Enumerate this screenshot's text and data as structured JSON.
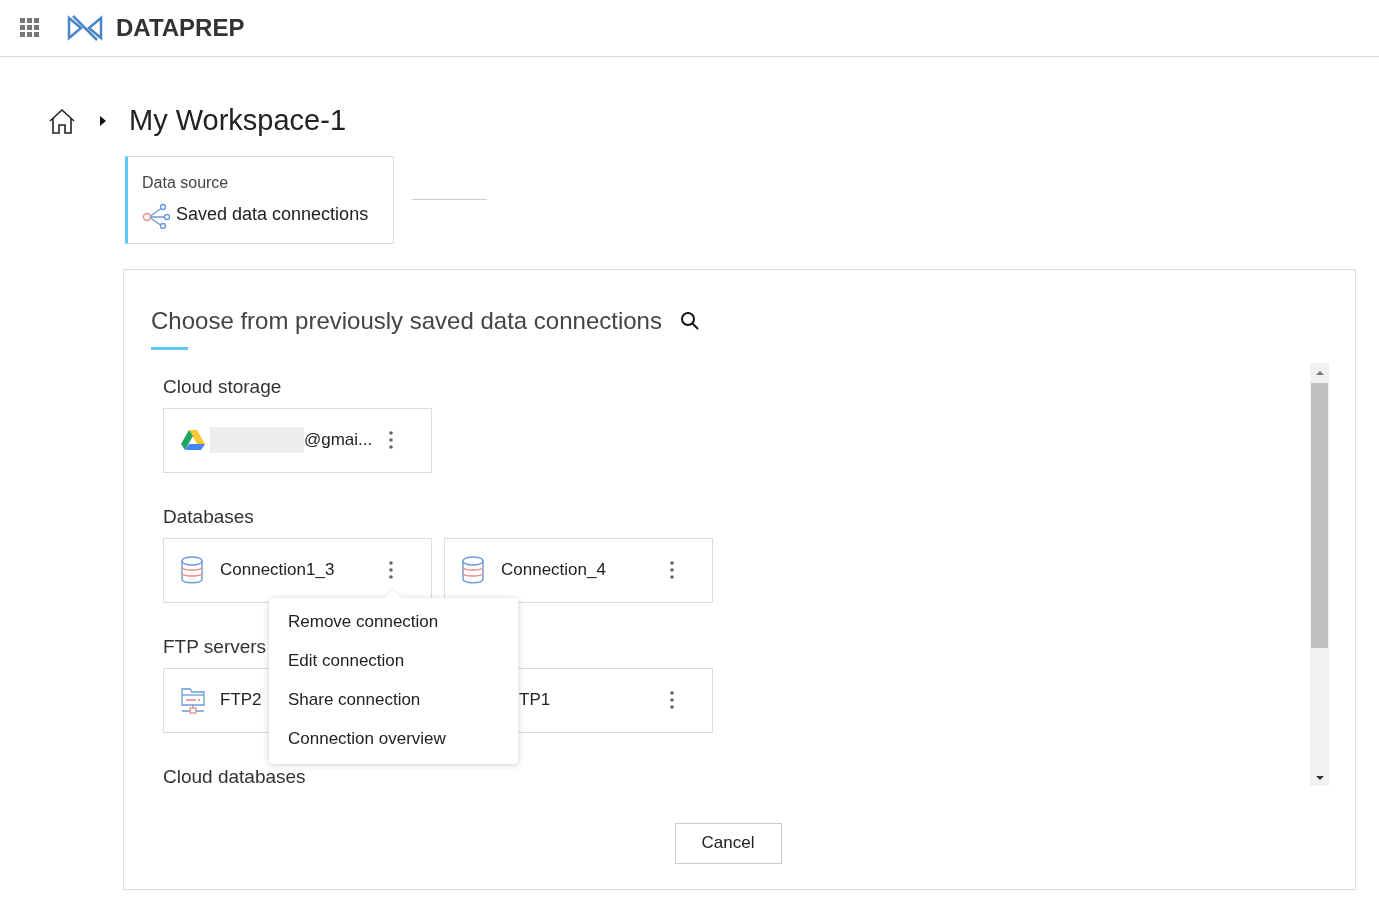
{
  "app": {
    "title": "DATAPREP"
  },
  "breadcrumb": {
    "title": "My Workspace-1"
  },
  "steps": [
    {
      "label": "Data source",
      "value": "Saved data connections",
      "selected": true
    }
  ],
  "panel": {
    "title": "Choose from previously saved data connections",
    "sections": [
      {
        "title": "Cloud storage",
        "connections": [
          {
            "kind": "drive",
            "name": "@gmai...",
            "redacted": true,
            "menu_open": false
          }
        ]
      },
      {
        "title": "Databases",
        "connections": [
          {
            "kind": "database",
            "name": "Connection1_3",
            "redacted": false,
            "menu_open": true
          },
          {
            "kind": "database",
            "name": "Connection_4",
            "redacted": false,
            "menu_open": false
          }
        ]
      },
      {
        "title": "FTP servers",
        "connections": [
          {
            "kind": "ftp",
            "name": "FTP2",
            "redacted": false,
            "menu_open": false
          },
          {
            "kind": "covered",
            "name": "TP1",
            "redacted": false,
            "menu_open": false
          }
        ]
      },
      {
        "title": "Cloud databases"
      }
    ],
    "context_menu": [
      "Remove connection",
      "Edit connection",
      "Share connection",
      "Connection overview"
    ],
    "cancel": "Cancel"
  }
}
